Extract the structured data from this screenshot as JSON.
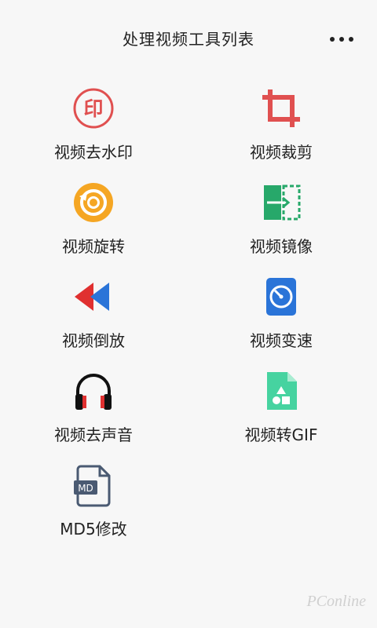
{
  "header": {
    "title": "处理视频工具列表",
    "more_icon": "more-horizontal-icon"
  },
  "tools": [
    {
      "label": "视频去水印",
      "icon": "watermark-stamp-icon"
    },
    {
      "label": "视频裁剪",
      "icon": "crop-icon"
    },
    {
      "label": "视频旋转",
      "icon": "rotate-icon"
    },
    {
      "label": "视频镜像",
      "icon": "mirror-icon"
    },
    {
      "label": "视频倒放",
      "icon": "rewind-icon"
    },
    {
      "label": "视频变速",
      "icon": "speed-gauge-icon"
    },
    {
      "label": "视频去声音",
      "icon": "headphones-icon"
    },
    {
      "label": "视频转GIF",
      "icon": "image-file-icon"
    },
    {
      "label": "MD5修改",
      "icon": "md-file-icon"
    }
  ],
  "icon_texts": {
    "watermark": "印",
    "md": "MD"
  },
  "watermark_text": "PConline",
  "colors": {
    "background": "#f7f7f7",
    "red": "#e05050",
    "orange": "#f5a623",
    "green": "#27a86a",
    "blue": "#2a74d8",
    "slate": "#4a5a72",
    "mint": "#46d3a0"
  }
}
